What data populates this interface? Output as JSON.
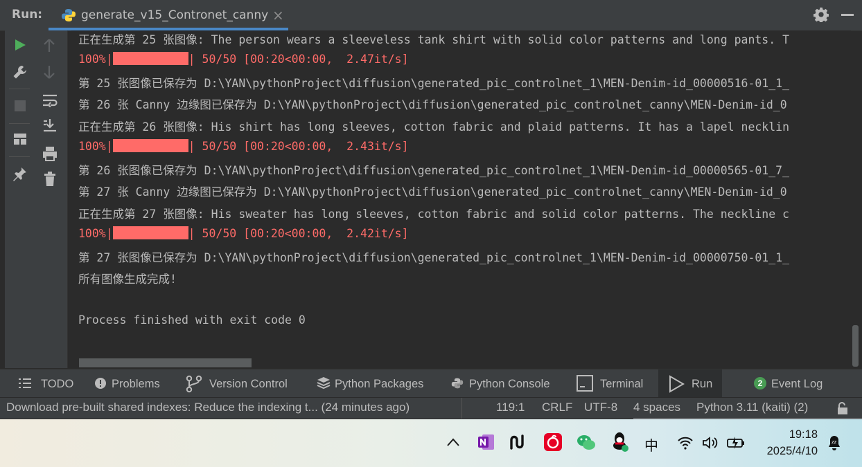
{
  "header": {
    "run_label": "Run:",
    "tab_label": "generate_v15_Contronet_canny",
    "close_glyph": "×"
  },
  "left_toolbar": {
    "icons": [
      "run-icon",
      "wrench-icon",
      "stop-icon",
      "layout-icon",
      "pin-icon",
      "up-arrow-icon",
      "down-arrow-icon",
      "soft-wrap-icon",
      "scroll-to-end-icon",
      "print-icon",
      "trash-icon"
    ]
  },
  "console": {
    "lines": [
      {
        "text": "正在生成第 25 张图像: The person wears a sleeveless tank shirt with solid color patterns and long pants. T",
        "type": "normal"
      },
      {
        "prefix": "100%|",
        "suffix": "| 50/50 [00:20<00:00,  2.47it/s]",
        "type": "progress"
      },
      {
        "text": "第 25 张图像已保存为 D:\\YAN\\pythonProject\\diffusion\\generated_pic_controlnet_1\\MEN-Denim-id_00000516-01_1_",
        "type": "normal"
      },
      {
        "text": "第 26 张 Canny 边缘图已保存为 D:\\YAN\\pythonProject\\diffusion\\generated_pic_controlnet_canny\\MEN-Denim-id_0",
        "type": "normal"
      },
      {
        "text": "正在生成第 26 张图像: His shirt has long sleeves, cotton fabric and plaid patterns. It has a lapel necklin",
        "type": "normal"
      },
      {
        "prefix": "100%|",
        "suffix": "| 50/50 [00:20<00:00,  2.43it/s]",
        "type": "progress"
      },
      {
        "text": "第 26 张图像已保存为 D:\\YAN\\pythonProject\\diffusion\\generated_pic_controlnet_1\\MEN-Denim-id_00000565-01_7_",
        "type": "normal"
      },
      {
        "text": "第 27 张 Canny 边缘图已保存为 D:\\YAN\\pythonProject\\diffusion\\generated_pic_controlnet_canny\\MEN-Denim-id_0",
        "type": "normal"
      },
      {
        "text": "正在生成第 27 张图像: His sweater has long sleeves, cotton fabric and solid color patterns. The neckline c",
        "type": "normal"
      },
      {
        "prefix": "100%|",
        "suffix": "| 50/50 [00:20<00:00,  2.42it/s]",
        "type": "progress"
      },
      {
        "text": "第 27 张图像已保存为 D:\\YAN\\pythonProject\\diffusion\\generated_pic_controlnet_1\\MEN-Denim-id_00000750-01_1_",
        "type": "normal"
      },
      {
        "text": "所有图像生成完成!",
        "type": "normal"
      },
      {
        "text": "",
        "type": "normal"
      },
      {
        "text": "Process finished with exit code 0",
        "type": "normal"
      }
    ]
  },
  "tool_windows": [
    {
      "label": "TODO",
      "icon": "list-icon",
      "active": false
    },
    {
      "label": "Problems",
      "icon": "problems-icon",
      "active": false
    },
    {
      "label": "Version Control",
      "icon": "branch-icon",
      "active": false
    },
    {
      "label": "Python Packages",
      "icon": "packages-icon",
      "active": false
    },
    {
      "label": "Python Console",
      "icon": "python-icon",
      "active": false
    },
    {
      "label": "Terminal",
      "icon": "terminal-icon",
      "active": false
    },
    {
      "label": "Run",
      "icon": "run-icon",
      "active": true
    },
    {
      "label": "Event Log",
      "icon": "event-log-icon",
      "badge": "2",
      "active": false
    }
  ],
  "status_bar": {
    "message": "Download pre-built shared indexes: Reduce the indexing t... (24 minutes ago)",
    "position": "119:1",
    "line_separator": "CRLF",
    "encoding": "UTF-8",
    "indent": "4 spaces",
    "interpreter": "Python 3.11 (kaiti) (2)"
  },
  "taskbar": {
    "ime": "中",
    "time": "19:18",
    "date": "2025/4/10",
    "colors": {
      "onenote": "#7719aa",
      "netease": "#e60026",
      "wechat": "#2aae67",
      "qq": "#111111"
    }
  }
}
